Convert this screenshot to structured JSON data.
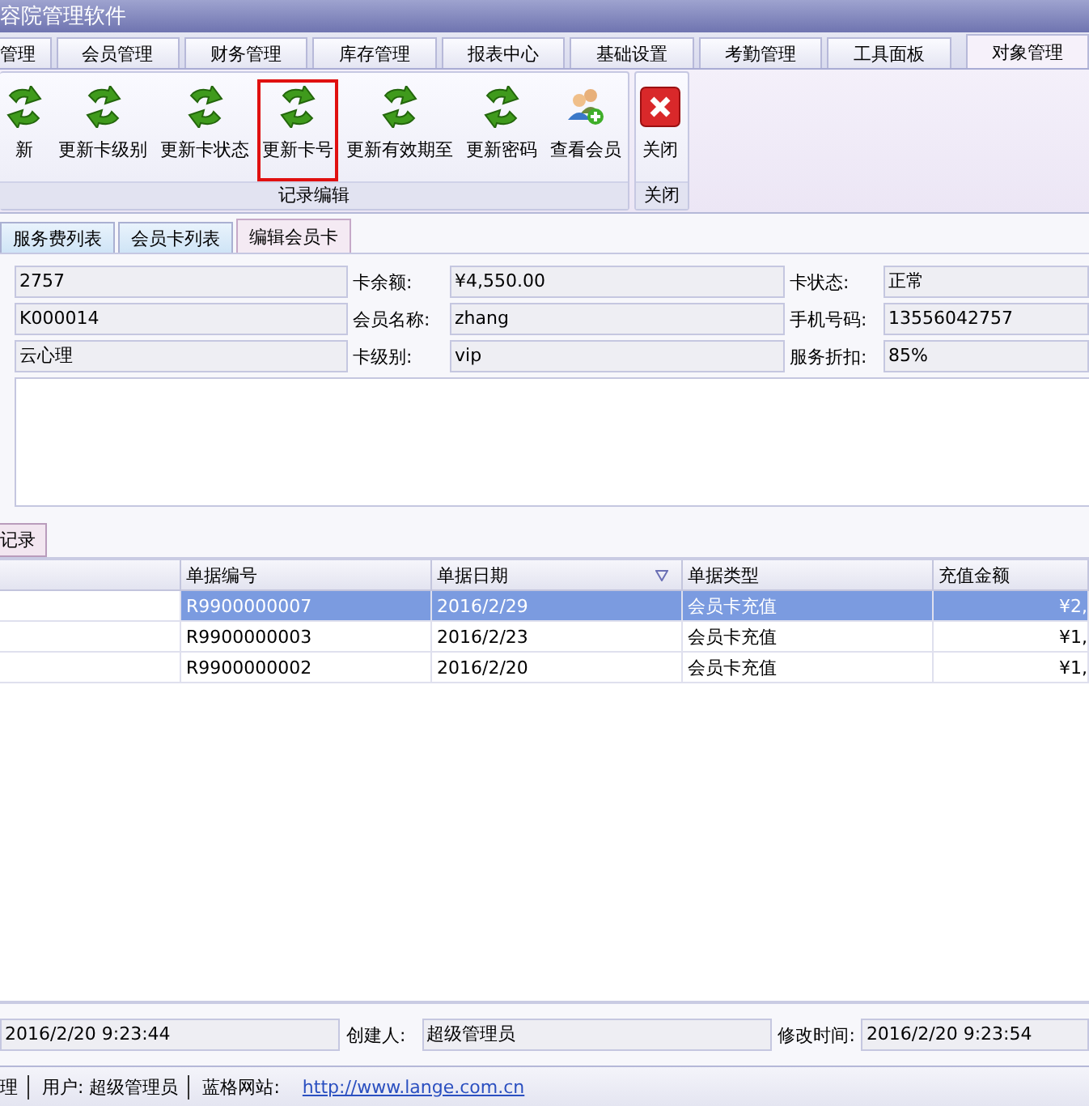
{
  "window": {
    "title": "容院管理软件"
  },
  "ribbon_tabs": [
    {
      "label": "管理",
      "selected": false
    },
    {
      "label": "会员管理",
      "selected": false
    },
    {
      "label": "财务管理",
      "selected": false
    },
    {
      "label": "库存管理",
      "selected": false
    },
    {
      "label": "报表中心",
      "selected": false
    },
    {
      "label": "基础设置",
      "selected": false
    },
    {
      "label": "考勤管理",
      "selected": false
    },
    {
      "label": "工具面板",
      "selected": false
    },
    {
      "label": "对象管理",
      "selected": true
    }
  ],
  "ribbon_groups": [
    {
      "label": "记录编辑",
      "buttons": [
        {
          "label": "新",
          "kind": "refresh",
          "highlighted": false
        },
        {
          "label": "更新卡级别",
          "kind": "refresh",
          "highlighted": false
        },
        {
          "label": "更新卡状态",
          "kind": "refresh",
          "highlighted": false
        },
        {
          "label": "更新卡号",
          "kind": "refresh",
          "highlighted": true
        },
        {
          "label": "更新有效期至",
          "kind": "refresh",
          "highlighted": false
        },
        {
          "label": "更新密码",
          "kind": "refresh",
          "highlighted": false
        },
        {
          "label": "查看会员",
          "kind": "members",
          "highlighted": false
        }
      ]
    },
    {
      "label": "关闭",
      "buttons": [
        {
          "label": "关闭",
          "kind": "close",
          "highlighted": false
        }
      ]
    }
  ],
  "doc_tabs": [
    {
      "label": "服务费列表",
      "selected": false
    },
    {
      "label": "会员卡列表",
      "selected": false
    },
    {
      "label": "编辑会员卡",
      "selected": true
    }
  ],
  "form_rows": [
    [
      {
        "value": "2757"
      },
      {
        "label": "卡余额:",
        "value": "¥4,550.00"
      },
      {
        "label": "卡状态:",
        "value": "正常"
      }
    ],
    [
      {
        "value": "K000014"
      },
      {
        "label": "会员名称:",
        "value": "zhang"
      },
      {
        "label": "手机号码:",
        "value": "13556042757"
      }
    ],
    [
      {
        "value": "云心理"
      },
      {
        "label": "卡级别:",
        "value": "vip"
      },
      {
        "label": "服务折扣:",
        "value": "85%"
      }
    ]
  ],
  "record_tab": {
    "label": "记录"
  },
  "table": {
    "columns": [
      {
        "label": "单据编号",
        "sorted": false
      },
      {
        "label": "单据日期",
        "sorted": true
      },
      {
        "label": "单据类型",
        "sorted": false
      },
      {
        "label": "充值金额",
        "sorted": false
      }
    ],
    "rows": [
      {
        "selected": true,
        "cells": [
          "R9900000007",
          "2016/2/29",
          "会员卡充值",
          "¥2,"
        ]
      },
      {
        "selected": false,
        "cells": [
          "R9900000003",
          "2016/2/23",
          "会员卡充值",
          "¥1,"
        ]
      },
      {
        "selected": false,
        "cells": [
          "R9900000002",
          "2016/2/20",
          "会员卡充值",
          "¥1,"
        ]
      }
    ]
  },
  "footer": [
    {
      "value": "2016/2/20 9:23:44"
    },
    {
      "label": "创建人:",
      "value": "超级管理员"
    },
    {
      "label": "修改时间:",
      "value": "2016/2/20 9:23:54"
    }
  ],
  "status_bar": {
    "items": [
      "理",
      "用户: 超级管理员",
      "蓝格网站:"
    ],
    "link": "http://www.lange.com.cn"
  }
}
